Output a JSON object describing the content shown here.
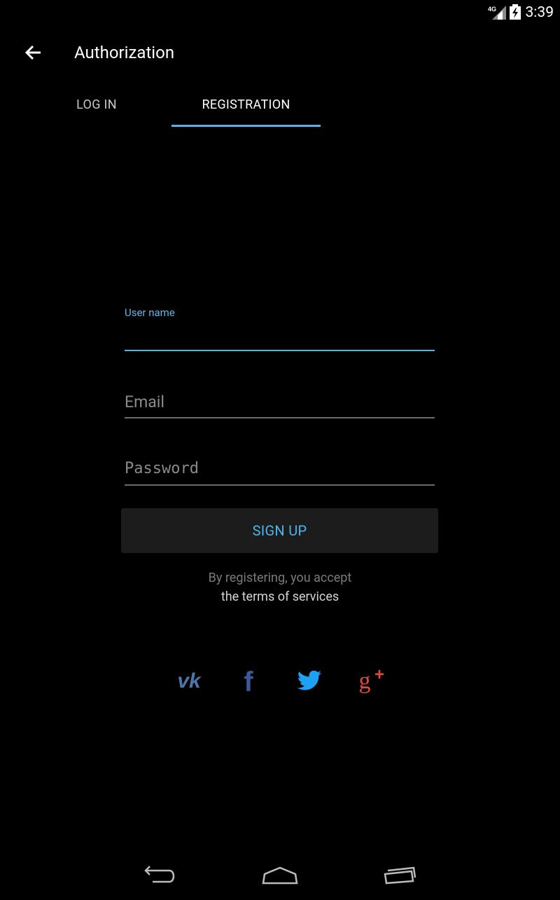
{
  "status_bar": {
    "time": "3:39",
    "network": "4G",
    "icons": [
      "signal-icon",
      "battery-icon"
    ]
  },
  "toolbar": {
    "title": "Authorization",
    "back_icon": "arrow-back-icon"
  },
  "tabs": [
    {
      "label": "LOG IN",
      "selected": false
    },
    {
      "label": "REGISTRATION",
      "selected": true
    }
  ],
  "form": {
    "username": {
      "label": "User name",
      "value": ""
    },
    "email": {
      "placeholder": "Email",
      "value": ""
    },
    "password": {
      "placeholder": "Password",
      "value": ""
    },
    "submit_label": "SIGN UP"
  },
  "terms": {
    "line1": "By registering, you accept",
    "line2": "the terms of services"
  },
  "social": [
    "vk-icon",
    "facebook-icon",
    "twitter-icon",
    "google-plus-icon"
  ],
  "nav_bar": [
    "nav-back-icon",
    "nav-home-icon",
    "nav-recents-icon"
  ],
  "colors": {
    "accent": "#4fb4ea",
    "background": "#000000",
    "button_bg": "#1c1c1c",
    "vk": "#4a76a8",
    "facebook": "#3b5998",
    "twitter": "#1da1f2",
    "google_plus": "#dd4b39"
  }
}
